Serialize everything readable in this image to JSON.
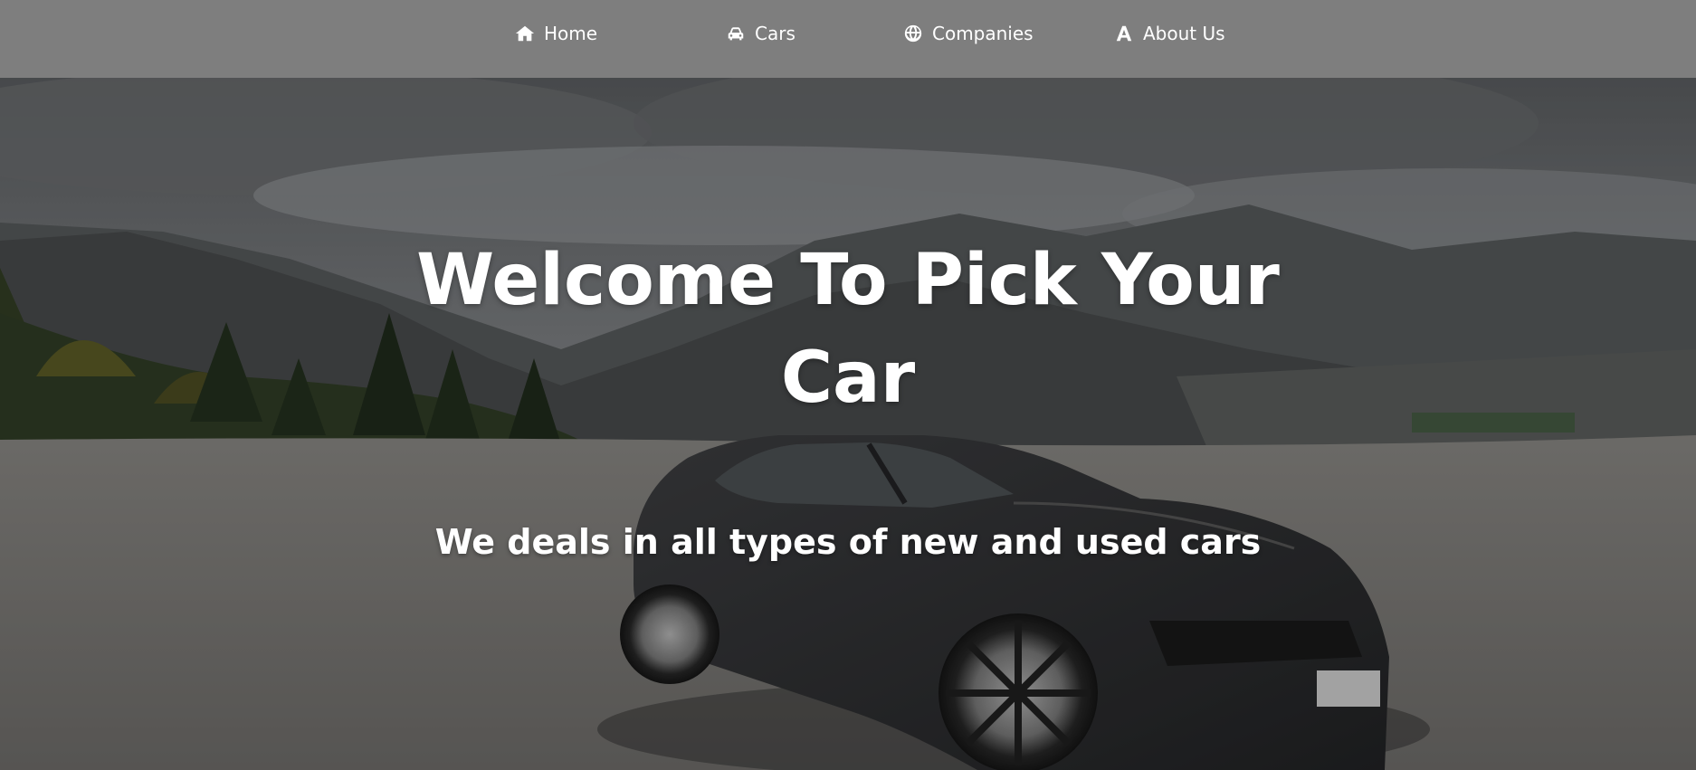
{
  "nav": {
    "items": [
      {
        "label": "Home",
        "icon": "home-icon"
      },
      {
        "label": "Cars",
        "icon": "car-icon"
      },
      {
        "label": "Companies",
        "icon": "globe-icon"
      },
      {
        "label": "About Us",
        "icon": "letter-a-icon"
      }
    ]
  },
  "hero": {
    "title": "Welcome To Pick Your Car",
    "subtitle": "We deals in all types of new and used cars"
  },
  "colors": {
    "nav_background": "#7e7e7e",
    "text": "#ffffff"
  }
}
